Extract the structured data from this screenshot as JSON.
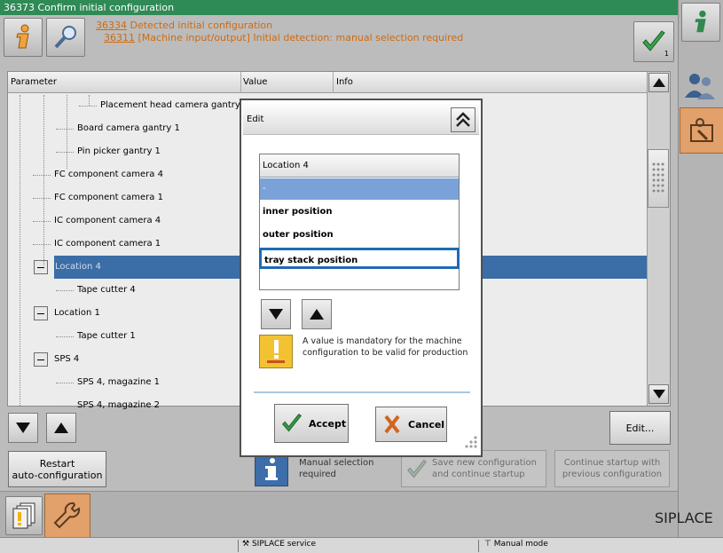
{
  "window": {
    "title": "36373 Confirm initial configuration"
  },
  "messages": {
    "line1_code": "36334",
    "line1_text": " Detected initial configuration",
    "line2_code": "36311",
    "line2_text": " [Machine input/output] Initial detection: manual selection required",
    "confirm_badge": "1"
  },
  "grid": {
    "columns": [
      "Parameter",
      "Value",
      "Info"
    ],
    "rows": [
      {
        "label": "Placement head camera gantry 1",
        "level": 4
      },
      {
        "label": "Board camera gantry 1",
        "level": 3
      },
      {
        "label": "Pin picker gantry 1",
        "level": 3
      },
      {
        "label": "FC component camera 4",
        "level": 2
      },
      {
        "label": "FC component camera 1",
        "level": 2
      },
      {
        "label": "IC component camera 4",
        "level": 2
      },
      {
        "label": "IC component camera 1",
        "level": 2
      },
      {
        "label": "Location 4",
        "level": 1,
        "expander": true,
        "selected": true
      },
      {
        "label": "Tape cutter 4",
        "level": 3
      },
      {
        "label": "Location 1",
        "level": 1,
        "expander": true
      },
      {
        "label": "Tape cutter 1",
        "level": 3
      },
      {
        "label": "SPS 4",
        "level": 1,
        "expander": true
      },
      {
        "label": "SPS 4, magazine 1",
        "level": 3
      },
      {
        "label": "SPS 4, magazine 2",
        "level": 3
      }
    ]
  },
  "buttons": {
    "edit": "Edit...",
    "restart": "Restart\nauto-configuration",
    "save_new": "Save new configuration\nand continue startup",
    "continue_prev": "Continue startup with\nprevious configuration"
  },
  "status": {
    "text": "Manual selection\nrequired"
  },
  "brand": {
    "name": "SIPLACE"
  },
  "footer": {
    "left": "SIPLACE service",
    "right": "Manual mode"
  },
  "dialog": {
    "title": "Edit",
    "list_header": "Location 4",
    "options": [
      "-",
      "inner position",
      "outer position",
      "tray stack position"
    ],
    "highlighted_index": 0,
    "focused_index": 3,
    "warning": "A value is mandatory for the machine configuration to be valid for production",
    "accept": "Accept",
    "cancel": "Cancel"
  },
  "colors": {
    "title_green": "#2f8a55",
    "selection_blue": "#3b6da6",
    "message_orange": "#d06a10",
    "tool_orange": "#e2a06a"
  }
}
